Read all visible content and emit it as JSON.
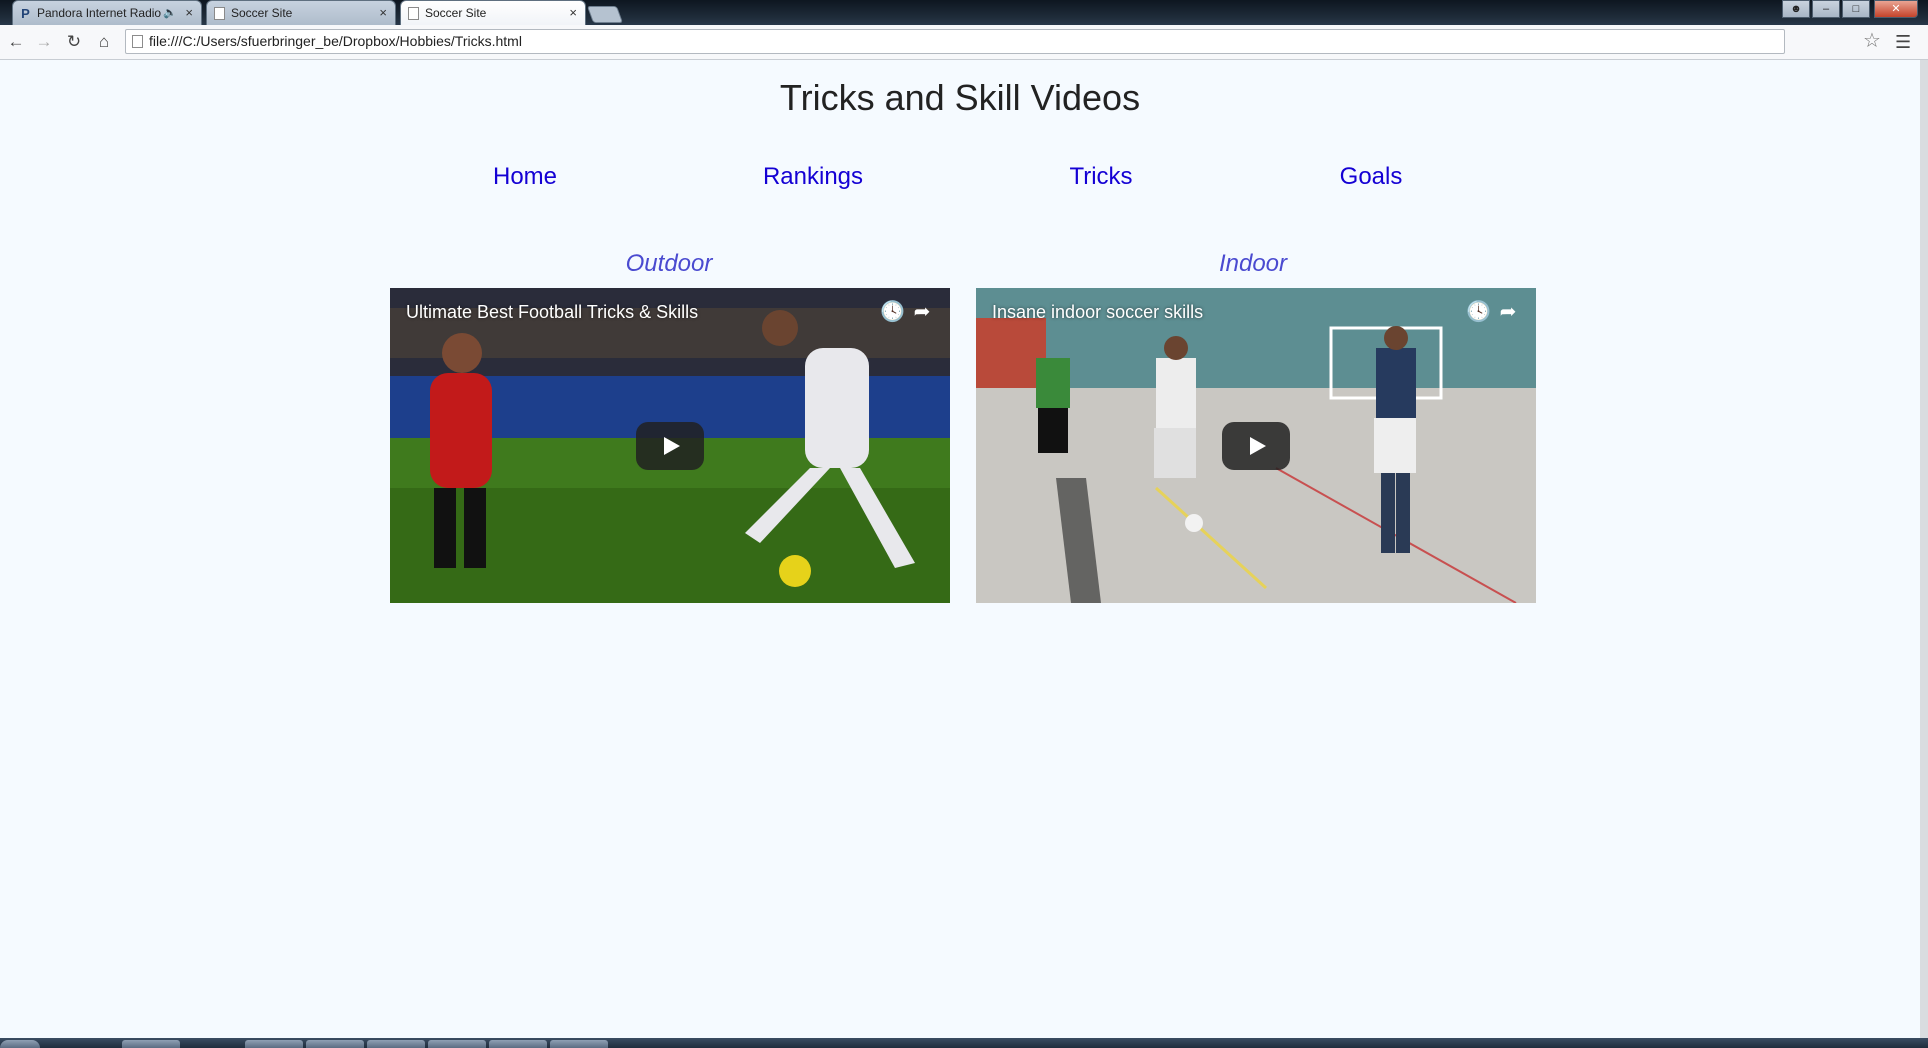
{
  "browser": {
    "tabs": [
      {
        "title": "Pandora Internet Radio",
        "icon": "pandora-icon",
        "audio": true
      },
      {
        "title": "Soccer Site",
        "icon": "document-icon"
      },
      {
        "title": "Soccer Site",
        "icon": "document-icon",
        "active": true
      }
    ],
    "url": "file:///C:/Users/sfuerbringer_be/Dropbox/Hobbies/Tricks.html"
  },
  "page": {
    "title": "Tricks and Skill Videos",
    "nav": [
      {
        "label": "Home"
      },
      {
        "label": "Rankings"
      },
      {
        "label": "Tricks"
      },
      {
        "label": "Goals"
      }
    ],
    "sections": [
      {
        "label": "Outdoor",
        "video_title": "Ultimate Best Football Tricks & Skills"
      },
      {
        "label": "Indoor",
        "video_title": "Insane indoor soccer skills"
      }
    ]
  },
  "colors": {
    "page_bg": "#f5faff",
    "link": "#1400d4",
    "section_label": "#4a4ad0"
  }
}
